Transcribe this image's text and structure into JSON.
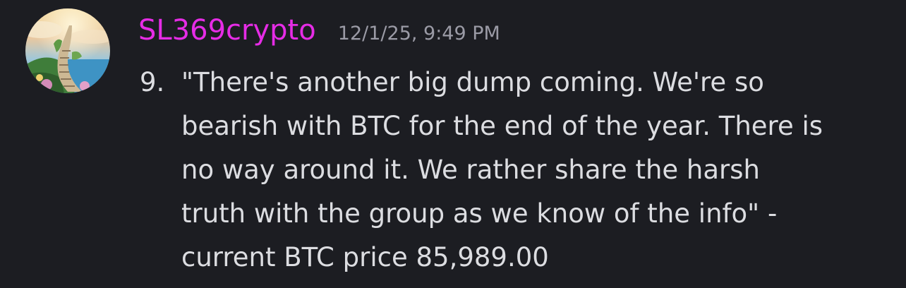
{
  "message": {
    "author": "SL369crypto",
    "timestamp": "12/1/25, 9:49 PM",
    "list_marker": "9.",
    "lines": [
      "\"There's another big dump coming. We're so",
      "bearish with BTC for the end of the year. There is",
      "no way around it. We rather share the harsh",
      "truth with the group as we know of the info\" -",
      "current BTC price 85,989.00"
    ]
  },
  "colors": {
    "background": "#1c1d22",
    "username": "#e62ce6",
    "timestamp": "#9b9ba6",
    "body_text": "#dcdde1"
  }
}
